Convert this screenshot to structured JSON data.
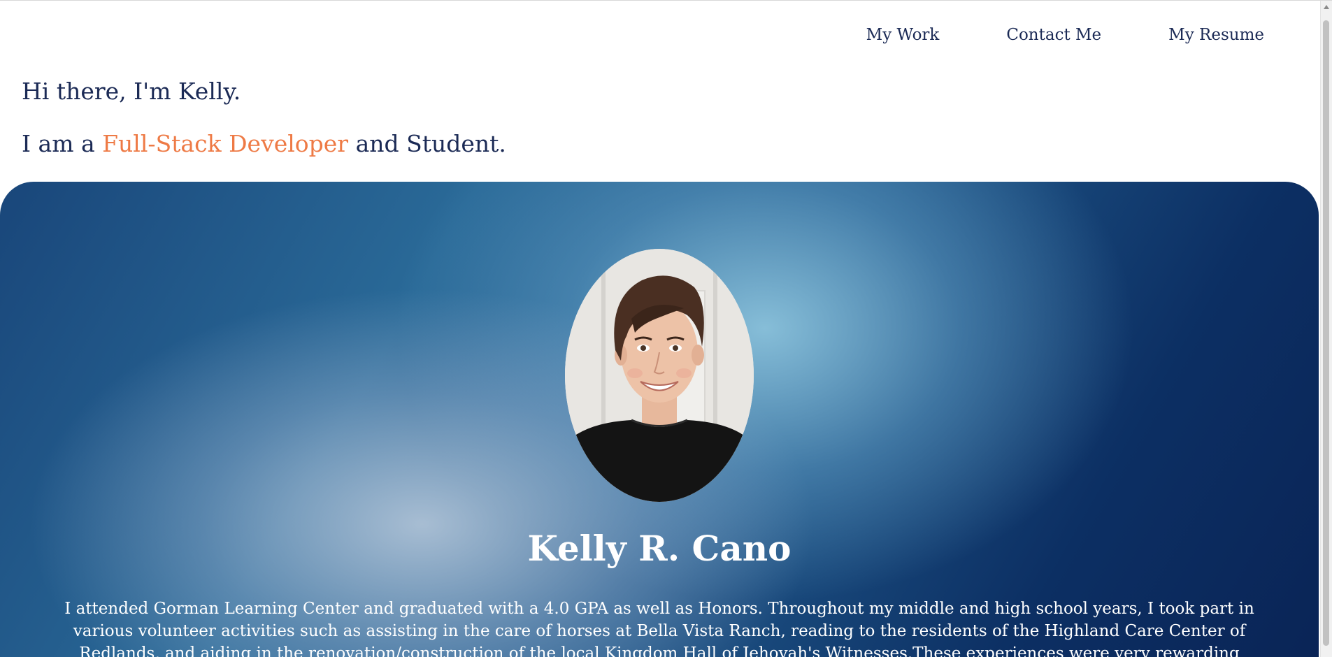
{
  "nav": {
    "items": [
      {
        "label": "My Work"
      },
      {
        "label": "Contact Me"
      },
      {
        "label": "My Resume"
      }
    ]
  },
  "intro": {
    "greeting": "Hi there, I'm Kelly.",
    "tagline_prefix": "I am a ",
    "tagline_role": "Full-Stack Developer",
    "tagline_suffix": " and Student."
  },
  "profile": {
    "name": "Kelly R. Cano",
    "bio": "I attended Gorman Learning Center and graduated with a 4.0 GPA as well as Honors. Throughout my middle and high school years, I took part in various volunteer activities such as assisting in the care of horses at Bella Vista Ranch, reading to the residents of the Highland Care Center of Redlands, and aiding in the renovation/construction of the local Kingdom Hall of Jehovah's Witnesses.These experiences were very rewarding and they helped me to see the"
  },
  "colors": {
    "text_primary": "#1b2a55",
    "accent": "#ee7a45",
    "hero_dark": "#0a2456",
    "hero_light": "#8cc3dc"
  }
}
